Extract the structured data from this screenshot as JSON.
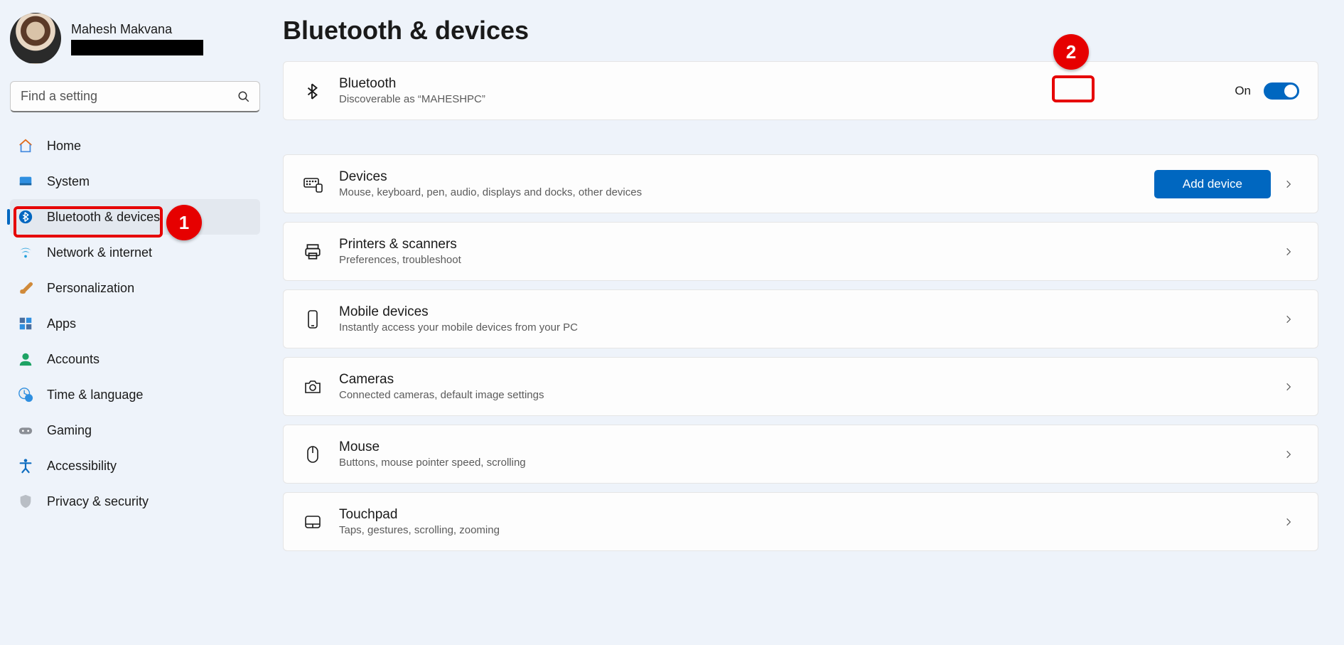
{
  "profile": {
    "name": "Mahesh Makvana"
  },
  "search": {
    "placeholder": "Find a setting"
  },
  "nav": [
    {
      "label": "Home"
    },
    {
      "label": "System"
    },
    {
      "label": "Bluetooth & devices"
    },
    {
      "label": "Network & internet"
    },
    {
      "label": "Personalization"
    },
    {
      "label": "Apps"
    },
    {
      "label": "Accounts"
    },
    {
      "label": "Time & language"
    },
    {
      "label": "Gaming"
    },
    {
      "label": "Accessibility"
    },
    {
      "label": "Privacy & security"
    }
  ],
  "page": {
    "title": "Bluetooth & devices"
  },
  "bluetooth_card": {
    "title": "Bluetooth",
    "sub": "Discoverable as “MAHESHPC”",
    "state": "On"
  },
  "devices_card": {
    "title": "Devices",
    "sub": "Mouse, keyboard, pen, audio, displays and docks, other devices",
    "button": "Add device"
  },
  "rows": [
    {
      "title": "Printers & scanners",
      "sub": "Preferences, troubleshoot"
    },
    {
      "title": "Mobile devices",
      "sub": "Instantly access your mobile devices from your PC"
    },
    {
      "title": "Cameras",
      "sub": "Connected cameras, default image settings"
    },
    {
      "title": "Mouse",
      "sub": "Buttons, mouse pointer speed, scrolling"
    },
    {
      "title": "Touchpad",
      "sub": "Taps, gestures, scrolling, zooming"
    }
  ],
  "callouts": {
    "one": "1",
    "two": "2"
  },
  "colors": {
    "accent": "#0067c0",
    "callout": "#e60000",
    "bg": "#eef3fa"
  }
}
